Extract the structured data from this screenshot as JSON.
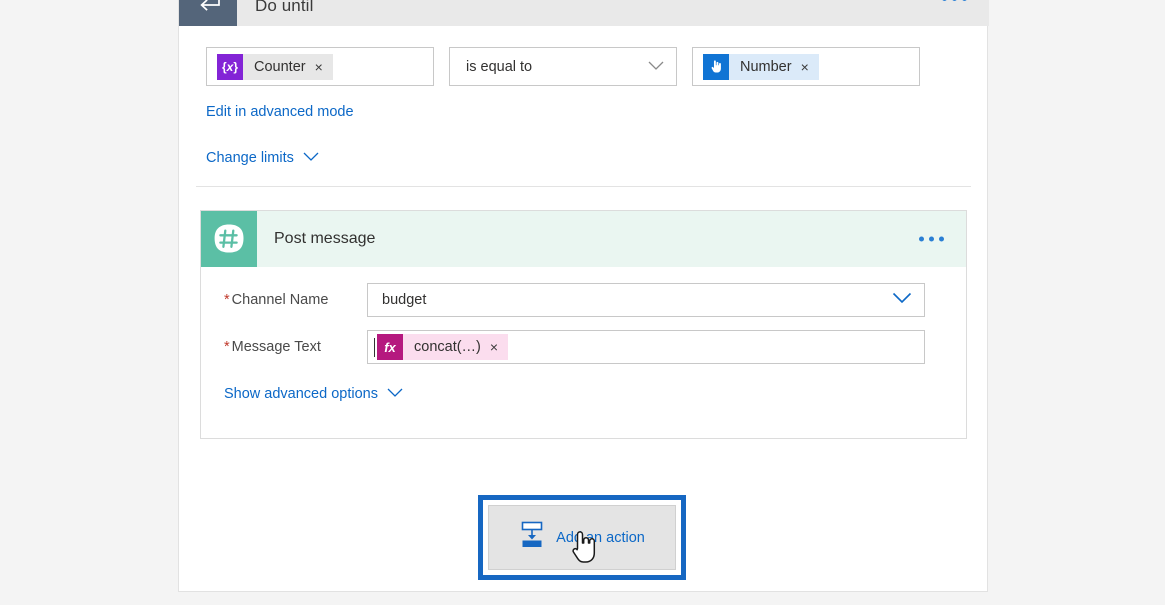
{
  "loop": {
    "title": "Do until",
    "icon": "loop-return-icon",
    "menu_icon": "overflow-menu-icon",
    "condition": {
      "left_token": {
        "label": "Counter",
        "icon": "variable-braces-icon",
        "remove": "×"
      },
      "operator": {
        "value": "is equal to",
        "chevron": "chevron-down-icon"
      },
      "right_token": {
        "label": "Number",
        "icon": "forms-hand-icon",
        "remove": "×"
      }
    },
    "advanced_mode_link": "Edit in advanced mode",
    "change_limits_link": "Change limits",
    "change_limits_chevron": "chevron-down-icon"
  },
  "action": {
    "title": "Post message",
    "icon": "slack-hash-icon",
    "menu_icon": "overflow-menu-icon",
    "fields": [
      {
        "label": "Channel Name",
        "required_marker": "*",
        "value": "budget",
        "control": "dropdown",
        "chevron": "chevron-down-icon"
      },
      {
        "label": "Message Text",
        "required_marker": "*",
        "value": "",
        "control": "token-input",
        "token": {
          "label": "concat(…)",
          "icon": "fx-expression-icon",
          "remove": "×"
        }
      }
    ],
    "show_advanced_link": "Show advanced options",
    "show_advanced_chevron": "chevron-down-icon"
  },
  "add_action": {
    "label": "Add an action",
    "icon": "insert-below-icon",
    "highlighted": true
  },
  "colors": {
    "page_background": "#f4f4f4",
    "card_background": "#ffffff",
    "header_strip": "#e9e9e9",
    "loop_icon": "#54657a",
    "slack_icon": "#5bbfa5",
    "action_header": "#eaf6f1",
    "variable_token": "#8324d6",
    "forms_token": "#1074d4",
    "expression_token": "#b5197f",
    "link_blue": "#0c68c7",
    "highlight_border": "#1667c2",
    "required_asterisk": "#c0392b"
  }
}
